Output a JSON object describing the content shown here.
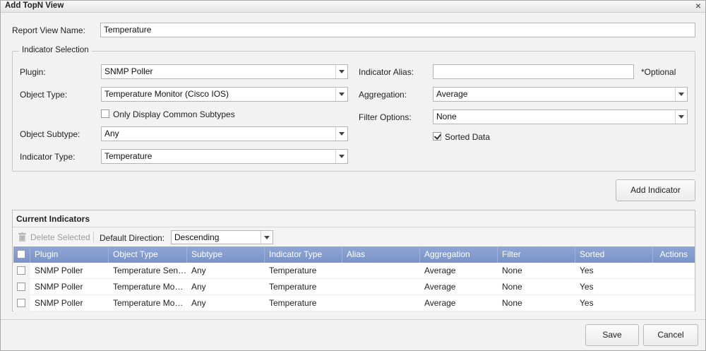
{
  "dialog": {
    "title": "Add TopN View",
    "close_glyph": "×"
  },
  "report_view": {
    "label": "Report View Name:",
    "value": "Temperature"
  },
  "indicator_selection": {
    "legend": "Indicator Selection",
    "plugin": {
      "label": "Plugin:",
      "value": "SNMP Poller"
    },
    "object_type": {
      "label": "Object Type:",
      "value": "Temperature Monitor (Cisco IOS)"
    },
    "only_common_subtypes": {
      "label": "Only Display Common Subtypes",
      "checked": false
    },
    "object_subtype": {
      "label": "Object Subtype:",
      "value": "Any"
    },
    "indicator_type": {
      "label": "Indicator Type:",
      "value": "Temperature"
    },
    "indicator_alias": {
      "label": "Indicator Alias:",
      "value": "",
      "hint": "*Optional"
    },
    "aggregation": {
      "label": "Aggregation:",
      "value": "Average"
    },
    "filter_options": {
      "label": "Filter Options:",
      "value": "None"
    },
    "sorted_data": {
      "label": "Sorted Data",
      "checked": true
    }
  },
  "add_indicator_button": "Add Indicator",
  "current_indicators": {
    "title": "Current Indicators",
    "delete_selected": "Delete Selected",
    "default_direction_label": "Default Direction:",
    "default_direction_value": "Descending",
    "columns": [
      "Plugin",
      "Object Type",
      "Subtype",
      "Indicator Type",
      "Alias",
      "Aggregation",
      "Filter",
      "Sorted",
      "Actions"
    ],
    "rows": [
      {
        "plugin": "SNMP Poller",
        "object_type": "Temperature Sensor",
        "subtype": "Any",
        "indicator_type": "Temperature",
        "alias": "",
        "aggregation": "Average",
        "filter": "None",
        "sorted": "Yes"
      },
      {
        "plugin": "SNMP Poller",
        "object_type": "Temperature Moni...",
        "subtype": "Any",
        "indicator_type": "Temperature",
        "alias": "",
        "aggregation": "Average",
        "filter": "None",
        "sorted": "Yes"
      },
      {
        "plugin": "SNMP Poller",
        "object_type": "Temperature Moni...",
        "subtype": "Any",
        "indicator_type": "Temperature",
        "alias": "",
        "aggregation": "Average",
        "filter": "None",
        "sorted": "Yes"
      }
    ]
  },
  "footer": {
    "save": "Save",
    "cancel": "Cancel"
  },
  "colors": {
    "grid_header": "#7f98cb",
    "dialog_bg": "#f2f2f2",
    "accent_border": "#b5b5b5"
  }
}
